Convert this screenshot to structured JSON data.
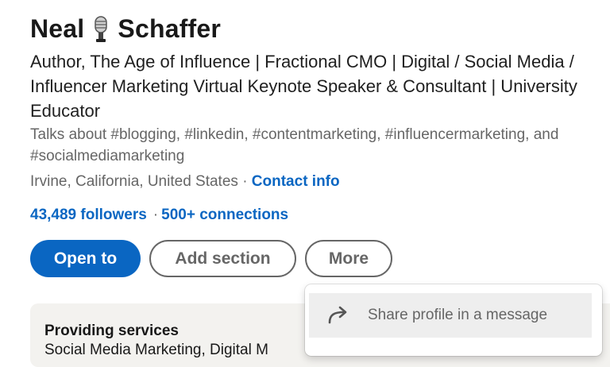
{
  "profile": {
    "first_name": "Neal",
    "last_name": "Schaffer",
    "name_icon": "microphone-icon",
    "headline": "Author, The Age of Influence | Fractional CMO | Digital / Social Media / Influencer Marketing Virtual Keynote Speaker & Consultant | University Educator",
    "talks_about": "Talks about #blogging, #linkedin, #contentmarketing, #influencermarketing, and #socialmediamarketing",
    "location": "Irvine, California, United States",
    "location_sep": "·",
    "contact_info_label": "Contact info",
    "followers": "43,489 followers",
    "stats_sep": "·",
    "connections": "500+ connections"
  },
  "actions": {
    "open_to_label": "Open to",
    "add_section_label": "Add section",
    "more_label": "More"
  },
  "services_card": {
    "title": "Providing services",
    "subtitle": "Social Media Marketing, Digital M"
  },
  "more_menu": {
    "items": [
      {
        "label": "Share profile in a message",
        "icon": "share-arrow-icon"
      }
    ]
  },
  "colors": {
    "brand_blue": "#0a66c2",
    "muted_text": "#666666",
    "card_bg": "#f3f2ef",
    "menu_hover": "#eeeeee"
  }
}
